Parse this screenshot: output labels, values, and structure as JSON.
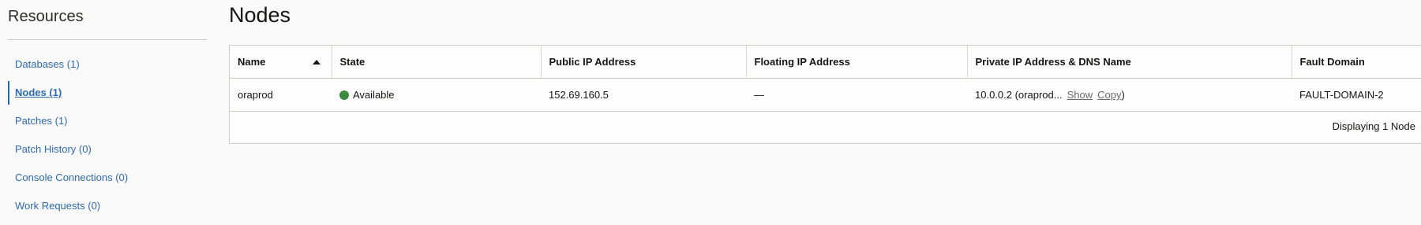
{
  "sidebar": {
    "title": "Resources",
    "items": [
      {
        "label": "Databases (1)"
      },
      {
        "label": "Nodes (1)"
      },
      {
        "label": "Patches (1)"
      },
      {
        "label": "Patch History (0)"
      },
      {
        "label": "Console Connections (0)"
      },
      {
        "label": "Work Requests (0)"
      }
    ]
  },
  "main": {
    "title": "Nodes",
    "table": {
      "columns": [
        {
          "label": "Name"
        },
        {
          "label": "State"
        },
        {
          "label": "Public IP Address"
        },
        {
          "label": "Floating IP Address"
        },
        {
          "label": "Private IP Address & DNS Name"
        },
        {
          "label": "Fault Domain"
        }
      ],
      "rows": [
        {
          "name": "oraprod",
          "state": "Available",
          "public_ip": "152.69.160.5",
          "floating_ip": "—",
          "private_ip": "10.0.0.2 (oraprod...",
          "show_label": "Show",
          "copy_label": "Copy",
          "close_paren": ")",
          "fault_domain": "FAULT-DOMAIN-2"
        }
      ],
      "footer_text": "Displaying 1 Node"
    },
    "colors": {
      "available": "#3a8a3f",
      "link": "#2d6ab0"
    }
  }
}
